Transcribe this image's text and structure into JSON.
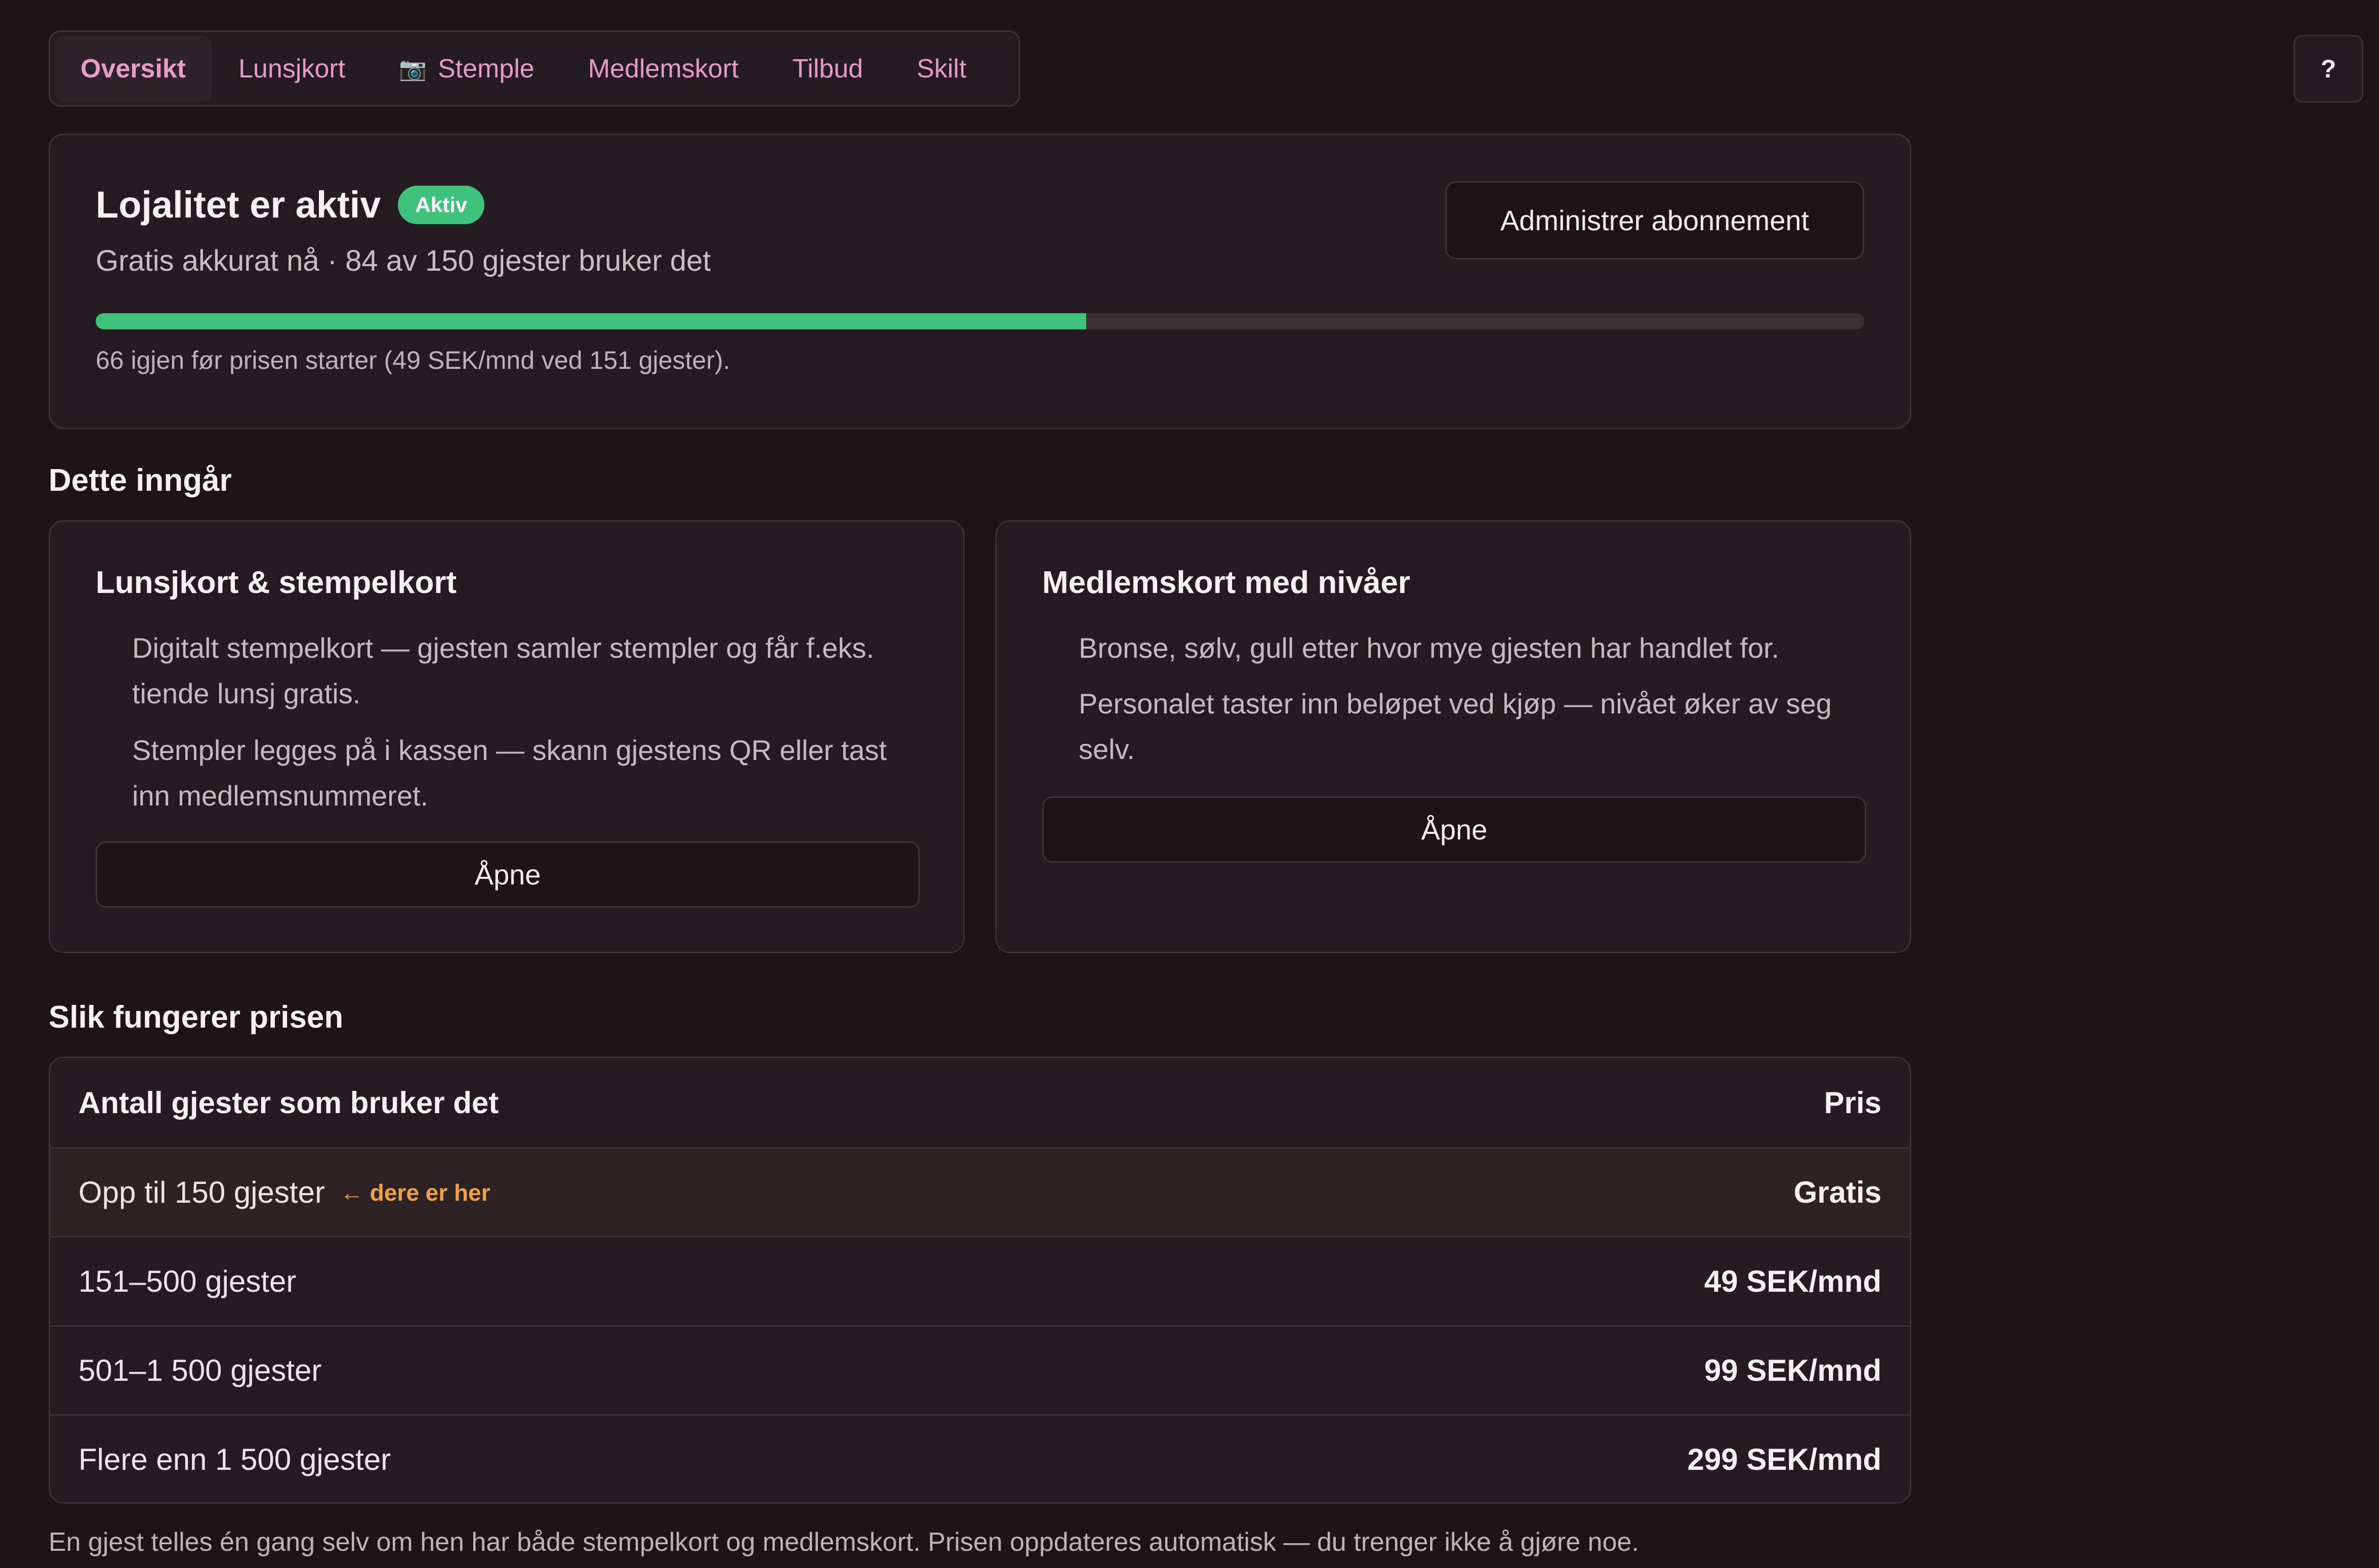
{
  "tabs": [
    {
      "label": "Oversikt",
      "active": true
    },
    {
      "label": "Lunsjkort"
    },
    {
      "label": "Stemple",
      "icon": "camera-icon"
    },
    {
      "label": "Medlemskort"
    },
    {
      "label": "Tilbud"
    },
    {
      "label": "Skilt"
    }
  ],
  "help_label": "?",
  "status": {
    "title": "Lojalitet er aktiv",
    "badge": "Aktiv",
    "subtitle": "Gratis akkurat nå · 84 av 150 gjester bruker det",
    "manage_label": "Administrer abonnement",
    "progress": 0.56,
    "note": "66 igjen før prisen starter (49 SEK/mnd ved 151 gjester)."
  },
  "included": {
    "title": "Dette inngår",
    "cards": [
      {
        "title": "Lunsjkort & stempelkort",
        "lines": [
          "Digitalt stempelkort — gjesten samler stempler og får f.eks. tiende lunsj gratis.",
          "Stempler legges på i kassen — skann gjestens QR eller tast inn medlemsnummeret."
        ],
        "button": "Åpne"
      },
      {
        "title": "Medlemskort med nivåer",
        "lines": [
          "Bronse, sølv, gull etter hvor mye gjesten har handlet for.",
          "Personalet taster inn beløpet ved kjøp — nivået øker av seg selv."
        ],
        "button": "Åpne"
      }
    ]
  },
  "pricing": {
    "title": "Slik fungerer prisen",
    "header": {
      "col1": "Antall gjester som bruker det",
      "col2": "Pris"
    },
    "rows": [
      {
        "label": "Opp til 150 gjester",
        "tag": "← dere er her",
        "price": "Gratis"
      },
      {
        "label": "151–500 gjester",
        "price": "49 SEK/mnd"
      },
      {
        "label": "501–1 500 gjester",
        "price": "99 SEK/mnd"
      },
      {
        "label": "Flere enn 1 500 gjester",
        "price": "299 SEK/mnd"
      }
    ],
    "footnote": "En gjest telles én gang selv om hen har både stempelkort og medlemskort. Prisen oppdateres automatisk — du trenger ikke å gjøre noe."
  },
  "colors": {
    "background": "#1b1517",
    "accent_pink": "#e79bc2",
    "success_green": "#3fc37c",
    "highlight_orange": "#f0a046"
  }
}
